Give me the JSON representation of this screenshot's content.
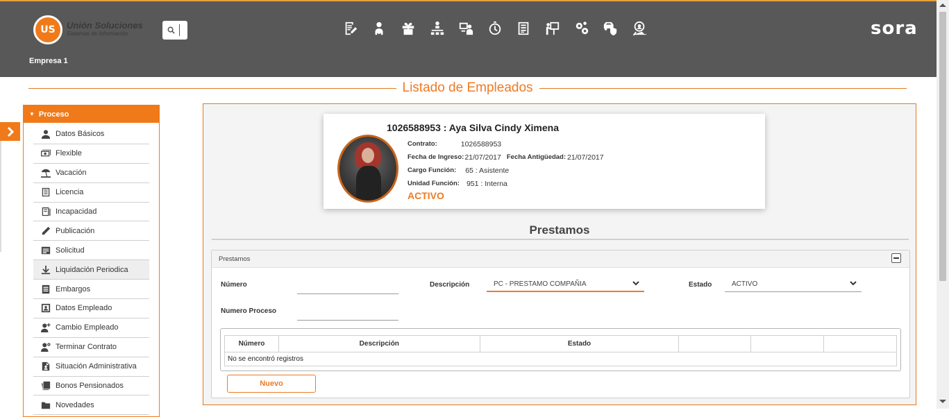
{
  "header": {
    "logo_mark": "US",
    "logo_title": "Unión Soluciones",
    "logo_subtitle": "Sistemas de Información",
    "brand": "sora",
    "company": "Empresa 1",
    "nav_icons": [
      "edit-document-icon",
      "user-hands-icon",
      "gift-icon",
      "org-chart-icon",
      "user-board-icon",
      "stopwatch-icon",
      "form-list-icon",
      "presentation-icon",
      "gears-icon",
      "car-shield-icon",
      "user-search-icon"
    ]
  },
  "page": {
    "title": "Listado de Empleados"
  },
  "sidebar": {
    "header": "Proceso",
    "items": [
      {
        "label": "Datos Básicos",
        "icon": "user-icon"
      },
      {
        "label": "Flexible",
        "icon": "money-icon"
      },
      {
        "label": "Vacación",
        "icon": "beach-icon"
      },
      {
        "label": "Licencia",
        "icon": "list-icon"
      },
      {
        "label": "Incapacidad",
        "icon": "book-icon"
      },
      {
        "label": "Publicación",
        "icon": "pencil-icon"
      },
      {
        "label": "Solicitud",
        "icon": "form-icon"
      },
      {
        "label": "Liquidación Periodica",
        "icon": "download-icon"
      },
      {
        "label": "Embargos",
        "icon": "doc-lines-icon"
      },
      {
        "label": "Datos Empleado",
        "icon": "user-card-icon"
      },
      {
        "label": "Cambio Empleado",
        "icon": "user-plus-icon"
      },
      {
        "label": "Terminar Contrato",
        "icon": "user-gear-icon"
      },
      {
        "label": "Situación Administrativa",
        "icon": "file-user-icon"
      },
      {
        "label": "Bonos Pensionados",
        "icon": "stack-icon"
      },
      {
        "label": "Novedades",
        "icon": "folder-icon"
      }
    ]
  },
  "employee": {
    "id_name": "1026588953 : Aya Silva Cindy Ximena",
    "contrato_label": "Contrato:",
    "contrato": "1026588953",
    "fecha_ingreso_label": "Fecha de Ingreso:",
    "fecha_ingreso": "21/07/2017",
    "fecha_antiguedad_label": "Fecha Antigüedad:",
    "fecha_antiguedad": "21/07/2017",
    "cargo_label": "Cargo Función:",
    "cargo": "65 : Asistente",
    "unidad_label": "Unidad Función:",
    "unidad": "951 : Interna",
    "status": "ACTIVO"
  },
  "section": {
    "title": "Prestamos"
  },
  "panel": {
    "title": "Prestamos",
    "numero_label": "Número",
    "numero_value": "",
    "descripcion_label": "Descripción",
    "descripcion_value": "PC - PRESTAMO COMPAÑIA",
    "estado_label": "Estado",
    "estado_value": "ACTIVO",
    "numero_proceso_label": "Numero Proceso",
    "numero_proceso_value": "",
    "table": {
      "headers": [
        "Número",
        "Descripción",
        "Estado",
        "",
        "",
        ""
      ],
      "empty_message": "No se encontró registros"
    },
    "new_button": "Nuevo"
  }
}
